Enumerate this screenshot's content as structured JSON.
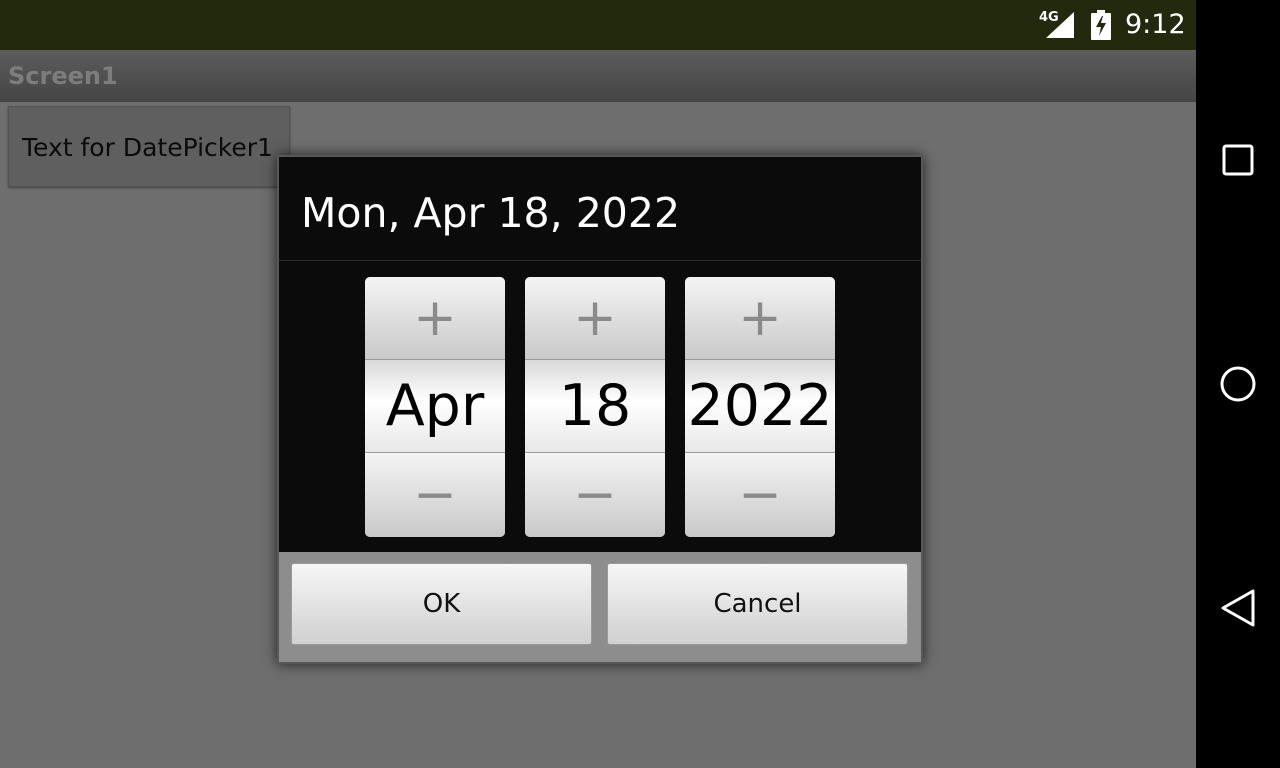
{
  "status_bar": {
    "network": "4G",
    "time": "9:12",
    "icons": [
      "signal-icon",
      "battery-charging-icon"
    ]
  },
  "title_bar": {
    "title": "Screen1"
  },
  "main": {
    "date_picker_button": "Text for DatePicker1"
  },
  "dialog": {
    "title": "Mon, Apr 18, 2022",
    "spinners": [
      {
        "name": "month",
        "value": "Apr",
        "increment": "+",
        "decrement": "−"
      },
      {
        "name": "day",
        "value": "18",
        "increment": "+",
        "decrement": "−"
      },
      {
        "name": "year",
        "value": "2022",
        "increment": "+",
        "decrement": "−"
      }
    ],
    "ok_label": "OK",
    "cancel_label": "Cancel"
  },
  "nav_bar": {
    "icons": [
      "recents-square-icon",
      "home-circle-icon",
      "back-triangle-icon"
    ]
  },
  "colors": {
    "status_bar": "#22290d",
    "app_background": "#6e6e6e",
    "dialog_background": "#0b0b0b",
    "nav_bar": "#000000"
  }
}
